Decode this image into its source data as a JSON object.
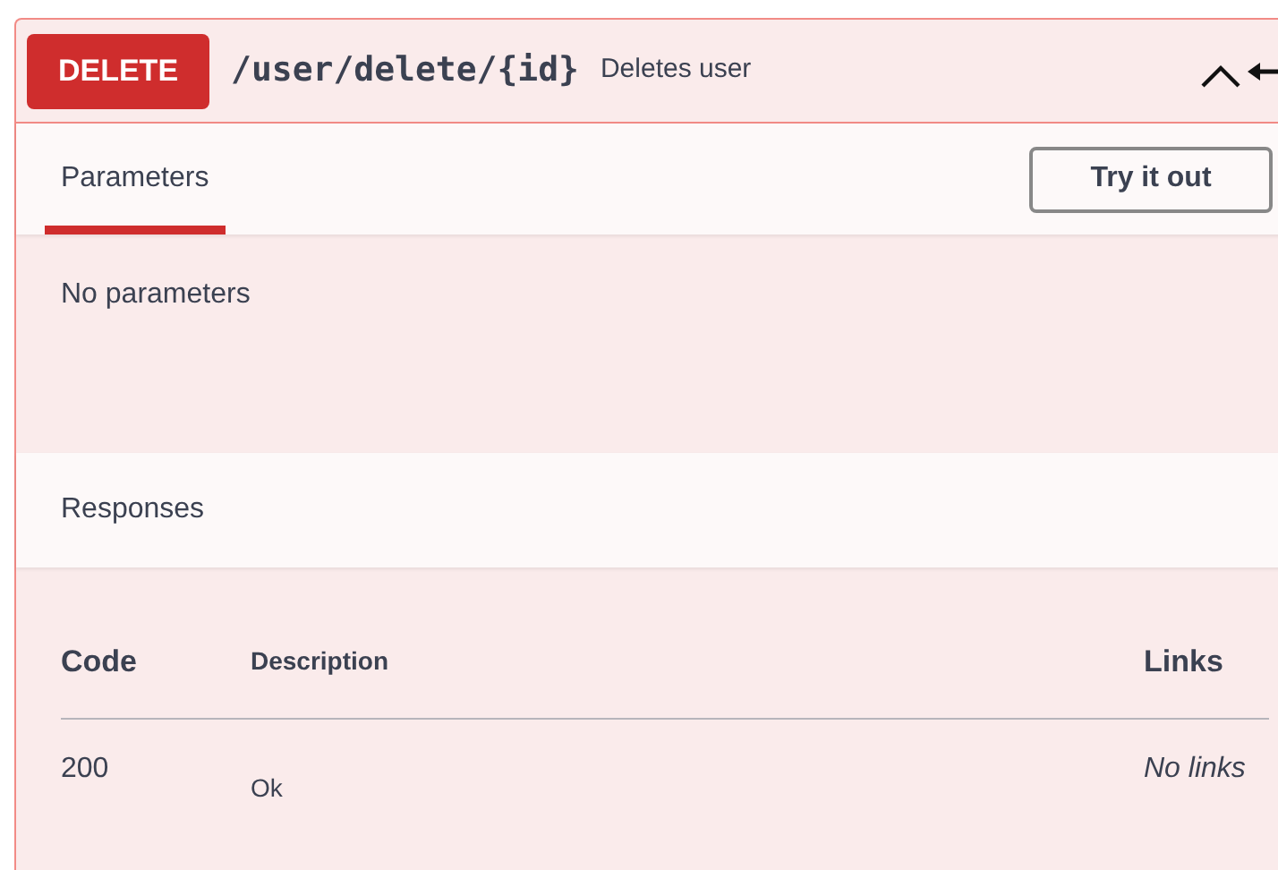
{
  "operation": {
    "method": "DELETE",
    "path": "/user/delete/{id}",
    "summary": "Deletes user",
    "expanded": true
  },
  "tabs": [
    {
      "label": "Parameters",
      "selected": true
    }
  ],
  "try_button": "Try it out",
  "parameters_message": "No parameters",
  "responses": {
    "title": "Responses",
    "columns": [
      "Code",
      "Description",
      "Links"
    ],
    "rows": [
      {
        "code": "200",
        "description": "Ok",
        "links": "No links"
      }
    ]
  }
}
